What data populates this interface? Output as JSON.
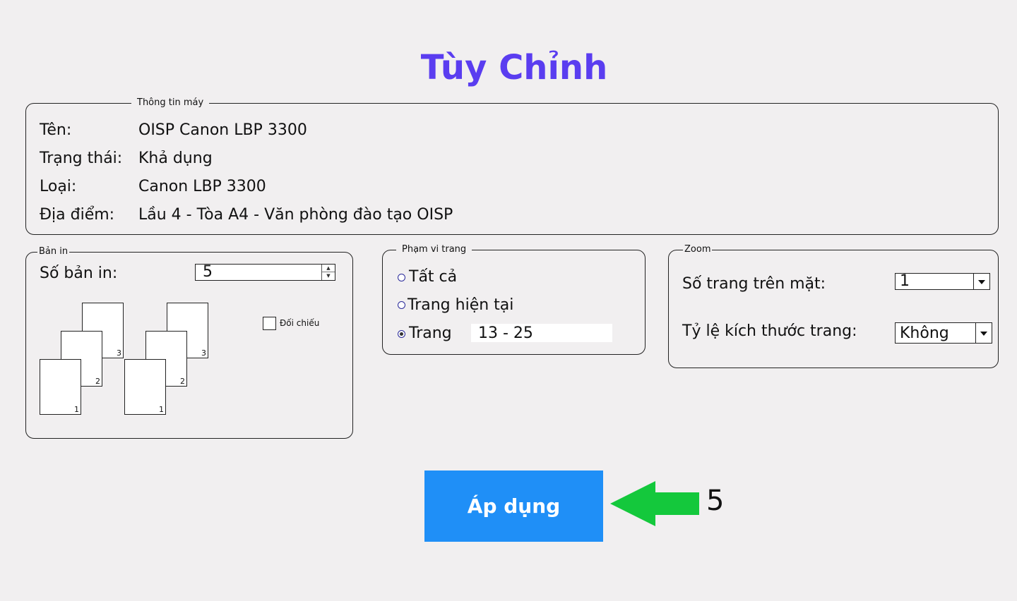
{
  "title": "Tùy Chỉnh",
  "machine_info": {
    "legend": "Thông tin máy",
    "rows": [
      {
        "label": "Tên:",
        "value": "OISP Canon LBP 3300"
      },
      {
        "label": "Trạng thái:",
        "value": "Khả dụng"
      },
      {
        "label": "Loại:",
        "value": "Canon LBP 3300"
      },
      {
        "label": "Địa điểm:",
        "value": "Lầu 4 - Tòa A4 - Văn phòng đào tạo OISP"
      }
    ]
  },
  "copies": {
    "legend": "Bản in",
    "label": "Số bản in:",
    "value": "5",
    "collate_label": "Đối chiếu",
    "collate_checked": false,
    "page_numbers": [
      "3",
      "2",
      "1"
    ]
  },
  "page_range": {
    "legend": "Phạm vi trang",
    "options": [
      {
        "label": "Tất cả",
        "selected": false
      },
      {
        "label": "Trang hiện tại",
        "selected": false
      },
      {
        "label": "Trang",
        "selected": true
      }
    ],
    "range_value": "13 - 25"
  },
  "zoom": {
    "legend": "Zoom",
    "pages_per_sheet_label": "Số trang trên mặt:",
    "pages_per_sheet_value": "1",
    "scale_label": "Tỷ lệ kích thước trang:",
    "scale_value": "Không"
  },
  "apply_button": "Áp dụng",
  "annotation": {
    "step": "5",
    "arrow_color": "#14c83c"
  },
  "colors": {
    "title": "#5a3df0",
    "button": "#1f8ff7",
    "background": "#f1eff0"
  }
}
